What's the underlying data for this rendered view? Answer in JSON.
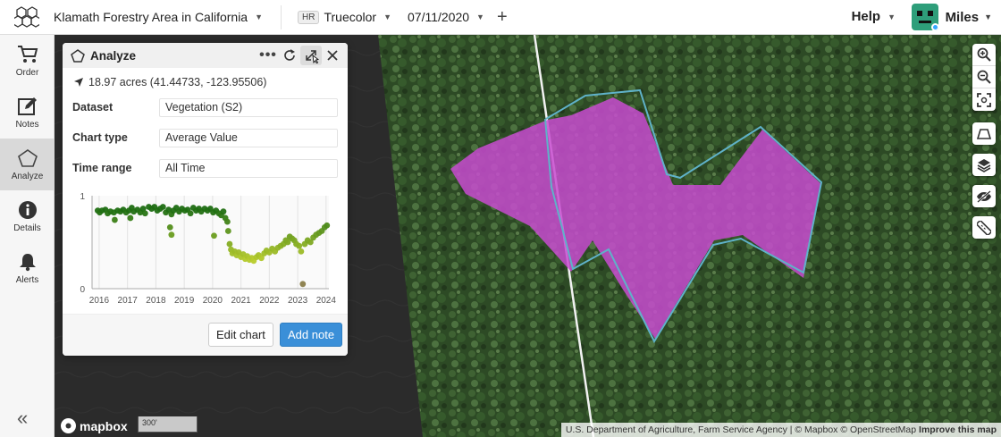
{
  "header": {
    "project_name": "Klamath Forestry Area in California",
    "layer_badge": "HR",
    "layer_name": "Truecolor",
    "date": "07/11/2020",
    "add_symbol": "+",
    "help_label": "Help",
    "user_name": "Miles"
  },
  "sidebar": {
    "items": [
      {
        "label": "Order",
        "icon": "cart-icon"
      },
      {
        "label": "Notes",
        "icon": "notes-icon"
      },
      {
        "label": "Analyze",
        "icon": "pentagon-icon",
        "active": true
      },
      {
        "label": "Details",
        "icon": "info-icon"
      },
      {
        "label": "Alerts",
        "icon": "bell-icon"
      }
    ],
    "collapse_symbol": "«"
  },
  "panel": {
    "title": "Analyze",
    "location": "18.97 acres (41.44733, -123.95506)",
    "dataset_label": "Dataset",
    "dataset_value": "Vegetation (S2)",
    "chart_type_label": "Chart type",
    "chart_type_value": "Average Value",
    "time_range_label": "Time range",
    "time_range_value": "All Time",
    "edit_chart_label": "Edit chart",
    "add_note_label": "Add note"
  },
  "map": {
    "scale_label": "300'",
    "mapbox_label": "mapbox",
    "attribution": "U.S. Department of Agriculture, Farm Service Agency | © Mapbox © OpenStreetMap",
    "improve_label": "Improve this map",
    "polygon_color": "#c84bd0",
    "outline_color": "#5fb2c9"
  },
  "chart_data": {
    "type": "scatter",
    "title": "",
    "xlabel": "",
    "ylabel": "",
    "ylim": [
      0,
      1
    ],
    "yticks": [
      "1",
      "0"
    ],
    "xticks": [
      "2016",
      "2017",
      "2018",
      "2019",
      "2020",
      "2021",
      "2022",
      "2023",
      "2024"
    ],
    "xlim": [
      2015.75,
      2024.1
    ],
    "colors": [
      "#1d6d12",
      "#b8cc2c"
    ],
    "points": [
      [
        2015.95,
        0.84
      ],
      [
        2016.02,
        0.82
      ],
      [
        2016.1,
        0.84
      ],
      [
        2016.22,
        0.85
      ],
      [
        2016.3,
        0.81
      ],
      [
        2016.4,
        0.83
      ],
      [
        2016.52,
        0.82
      ],
      [
        2016.65,
        0.84
      ],
      [
        2016.75,
        0.83
      ],
      [
        2016.85,
        0.85
      ],
      [
        2016.95,
        0.82
      ],
      [
        2017.05,
        0.84
      ],
      [
        2017.15,
        0.87
      ],
      [
        2017.22,
        0.83
      ],
      [
        2017.35,
        0.85
      ],
      [
        2017.45,
        0.82
      ],
      [
        2017.55,
        0.86
      ],
      [
        2017.62,
        0.81
      ],
      [
        2017.75,
        0.88
      ],
      [
        2017.85,
        0.86
      ],
      [
        2017.95,
        0.88
      ],
      [
        2018.05,
        0.84
      ],
      [
        2018.15,
        0.86
      ],
      [
        2018.25,
        0.88
      ],
      [
        2018.35,
        0.82
      ],
      [
        2018.45,
        0.85
      ],
      [
        2018.55,
        0.8
      ],
      [
        2018.62,
        0.84
      ],
      [
        2018.72,
        0.87
      ],
      [
        2018.82,
        0.83
      ],
      [
        2018.92,
        0.86
      ],
      [
        2019.02,
        0.84
      ],
      [
        2019.12,
        0.85
      ],
      [
        2019.22,
        0.81
      ],
      [
        2019.32,
        0.87
      ],
      [
        2019.42,
        0.84
      ],
      [
        2019.52,
        0.86
      ],
      [
        2019.6,
        0.83
      ],
      [
        2019.72,
        0.86
      ],
      [
        2019.82,
        0.84
      ],
      [
        2019.92,
        0.86
      ],
      [
        2020.02,
        0.82
      ],
      [
        2020.12,
        0.84
      ],
      [
        2020.22,
        0.81
      ],
      [
        2020.3,
        0.79
      ],
      [
        2020.38,
        0.83
      ],
      [
        2020.45,
        0.76
      ],
      [
        2020.52,
        0.72
      ],
      [
        2020.55,
        0.62
      ],
      [
        2020.6,
        0.48
      ],
      [
        2020.65,
        0.42
      ],
      [
        2020.7,
        0.38
      ],
      [
        2020.78,
        0.4
      ],
      [
        2020.85,
        0.36
      ],
      [
        2020.92,
        0.39
      ],
      [
        2021.0,
        0.34
      ],
      [
        2021.08,
        0.37
      ],
      [
        2021.15,
        0.32
      ],
      [
        2021.22,
        0.35
      ],
      [
        2021.3,
        0.31
      ],
      [
        2021.38,
        0.33
      ],
      [
        2021.45,
        0.3
      ],
      [
        2021.55,
        0.34
      ],
      [
        2021.62,
        0.36
      ],
      [
        2021.72,
        0.33
      ],
      [
        2021.82,
        0.38
      ],
      [
        2021.9,
        0.41
      ],
      [
        2022.0,
        0.39
      ],
      [
        2022.1,
        0.43
      ],
      [
        2022.2,
        0.4
      ],
      [
        2022.3,
        0.44
      ],
      [
        2022.4,
        0.46
      ],
      [
        2022.5,
        0.48
      ],
      [
        2022.58,
        0.52
      ],
      [
        2022.65,
        0.5
      ],
      [
        2022.72,
        0.56
      ],
      [
        2022.8,
        0.54
      ],
      [
        2022.88,
        0.52
      ],
      [
        2022.95,
        0.48
      ],
      [
        2023.05,
        0.46
      ],
      [
        2023.12,
        0.4
      ],
      [
        2023.18,
        0.05
      ],
      [
        2023.25,
        0.48
      ],
      [
        2023.35,
        0.52
      ],
      [
        2023.45,
        0.5
      ],
      [
        2023.55,
        0.55
      ],
      [
        2023.65,
        0.58
      ],
      [
        2023.75,
        0.6
      ],
      [
        2023.85,
        0.62
      ],
      [
        2023.95,
        0.66
      ],
      [
        2024.03,
        0.68
      ],
      [
        2018.5,
        0.66
      ],
      [
        2018.55,
        0.58
      ],
      [
        2020.05,
        0.57
      ],
      [
        2016.55,
        0.74
      ],
      [
        2017.1,
        0.76
      ]
    ]
  }
}
